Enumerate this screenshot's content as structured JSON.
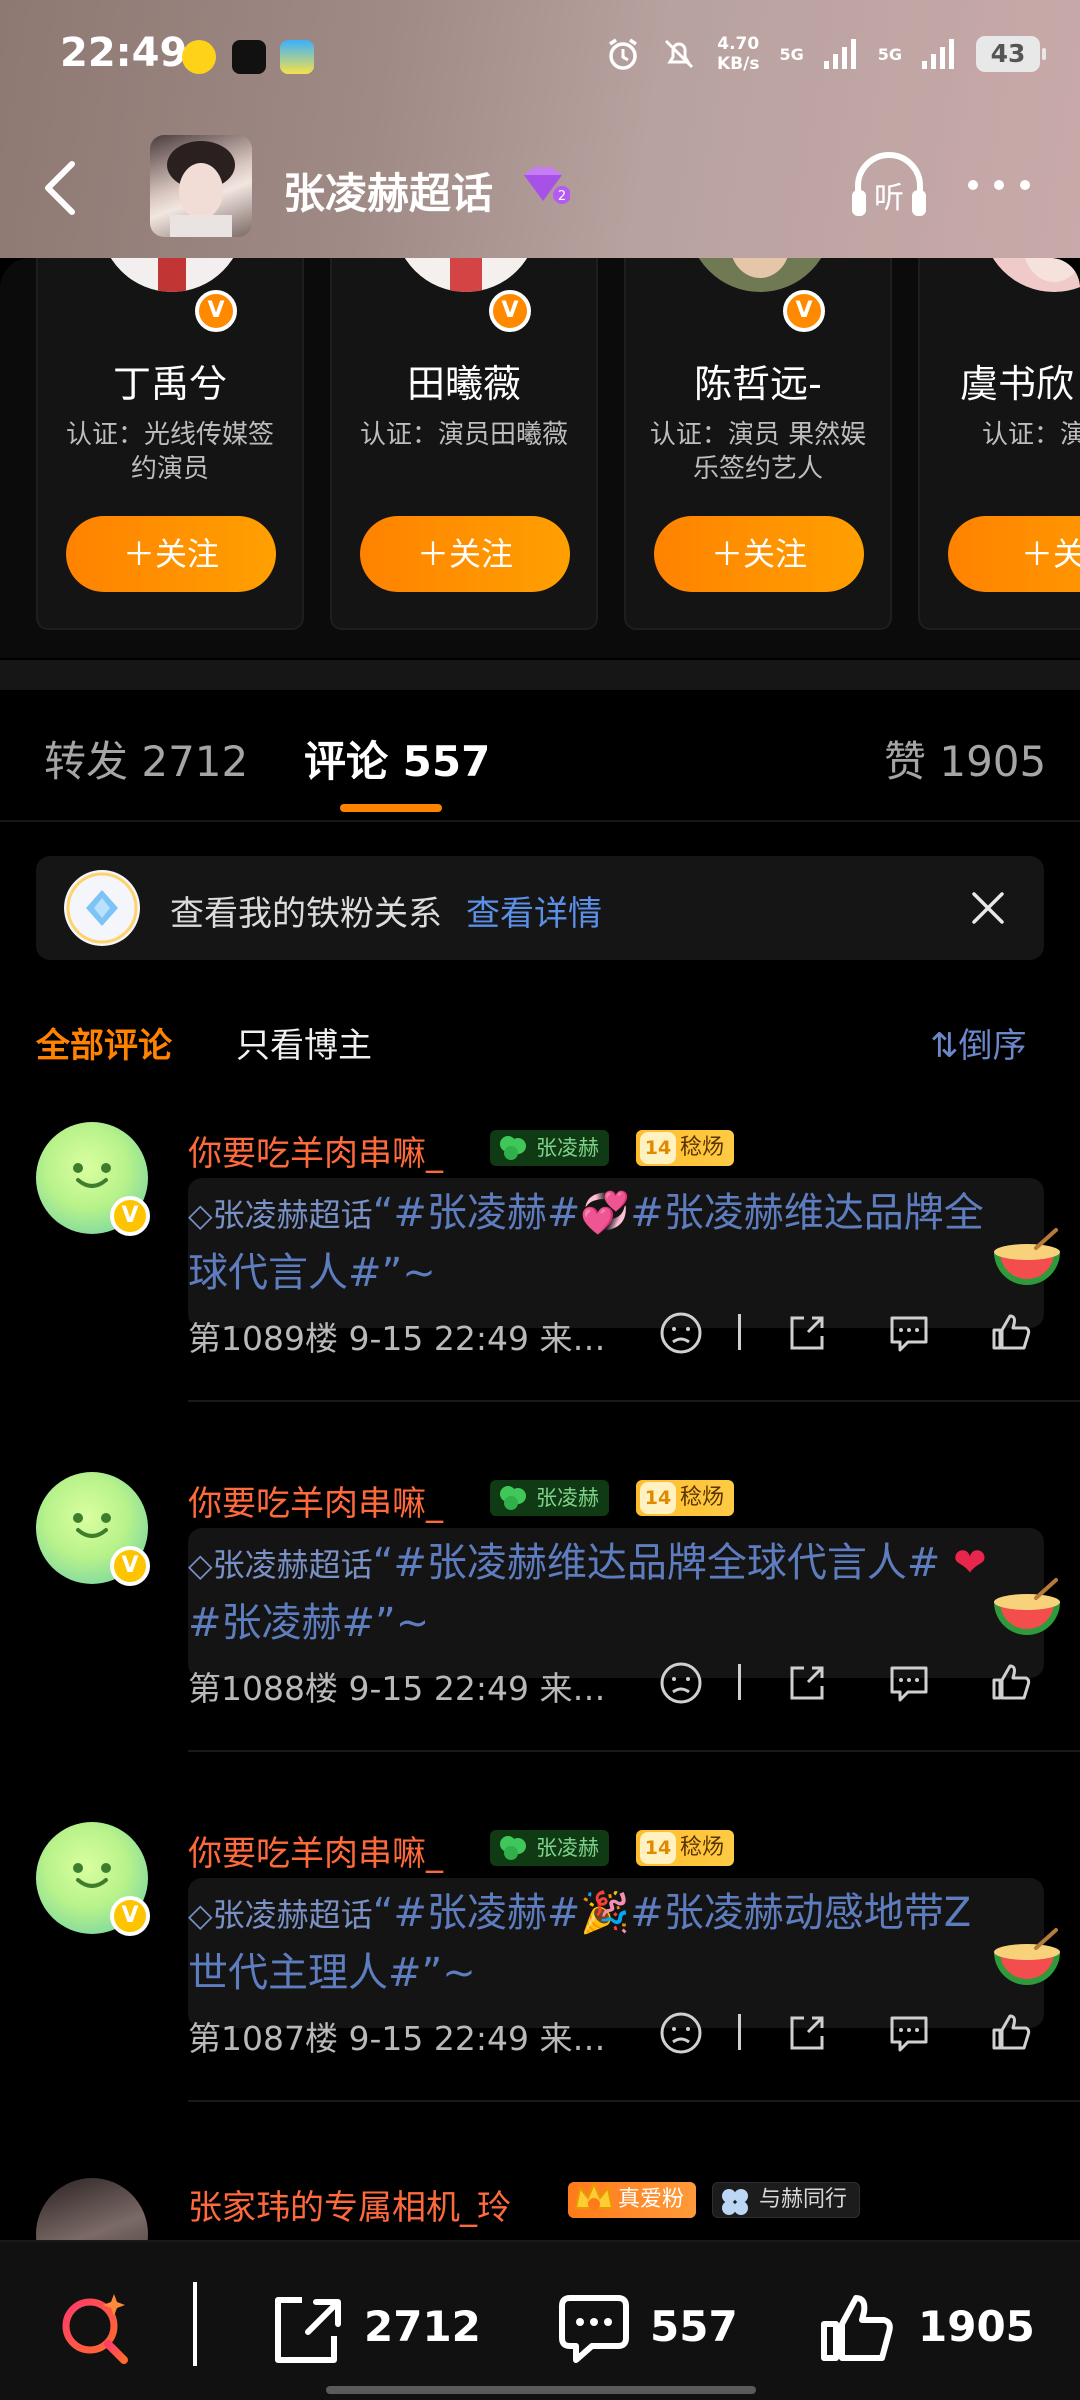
{
  "status_bar": {
    "time": "22:49",
    "speed_value": "4.70",
    "speed_unit": "KB/s",
    "net1": "5G",
    "net2": "5G",
    "battery": "43"
  },
  "header": {
    "title": "张凌赫超话",
    "level_icon": "purple-gem-level-2",
    "listen_label": "听"
  },
  "recommended_users": [
    {
      "name": "丁禹兮",
      "cert": "认证：光线传媒签约演员",
      "follow": "＋关注",
      "verified": "V"
    },
    {
      "name": "田曦薇",
      "cert": "认证：演员田曦薇",
      "follow": "＋关注",
      "verified": "V"
    },
    {
      "name": "陈哲远-",
      "cert": "认证：演员 果然娱乐签约艺人",
      "follow": "＋关注",
      "verified": "V"
    },
    {
      "name": "虞书欣",
      "cert": "认证：演",
      "follow": "＋关",
      "verified": ""
    }
  ],
  "tabs": [
    {
      "label": "转发 2712"
    },
    {
      "label": "评论 557"
    },
    {
      "label": "赞 1905"
    }
  ],
  "banner": {
    "text": "查看我的铁粉关系",
    "link": "查看详情"
  },
  "filter": {
    "all": "全部评论",
    "owner_only": "只看博主",
    "sort": "⇅倒序"
  },
  "comments": [
    {
      "name": "你要吃羊肉串嘛_",
      "group_badge": "张凌赫",
      "level": "14",
      "level_badge": "稔炀",
      "verified": "V",
      "text_prefix": "◇张凌赫超话",
      "text_a": "“#张凌赫#",
      "emoji": "💞",
      "text_b": "#张凌赫维达品牌全球代言人#”~",
      "meta": "第1089楼 9-15 22:49 来…"
    },
    {
      "name": "你要吃羊肉串嘛_",
      "group_badge": "张凌赫",
      "level": "14",
      "level_badge": "稔炀",
      "verified": "V",
      "text_prefix": "◇张凌赫超话",
      "text_a": "“#张凌赫维达品牌全球代言人# ",
      "emoji": "❤",
      "text_b": "#张凌赫#”~",
      "meta": "第1088楼 9-15 22:49 来…"
    },
    {
      "name": "你要吃羊肉串嘛_",
      "group_badge": "张凌赫",
      "level": "14",
      "level_badge": "稔炀",
      "verified": "V",
      "text_prefix": "◇张凌赫超话",
      "text_a": "“#张凌赫#",
      "emoji": "🎉",
      "text_b": "#张凌赫动感地带Z世代主理人#”~",
      "meta": "第1087楼 9-15 22:49 来…"
    }
  ],
  "comment4": {
    "name": "张家玮的专属相机_玲",
    "fan_badge": "真爱粉",
    "with_badge": "与赫同行"
  },
  "bottom_bar": {
    "reposts": "2712",
    "comments": "557",
    "likes": "1905"
  },
  "colors": {
    "accent": "#ff8200",
    "username": "#ff6a3d",
    "link": "#5b8fe8",
    "comment_text": "#5e7dbf"
  }
}
